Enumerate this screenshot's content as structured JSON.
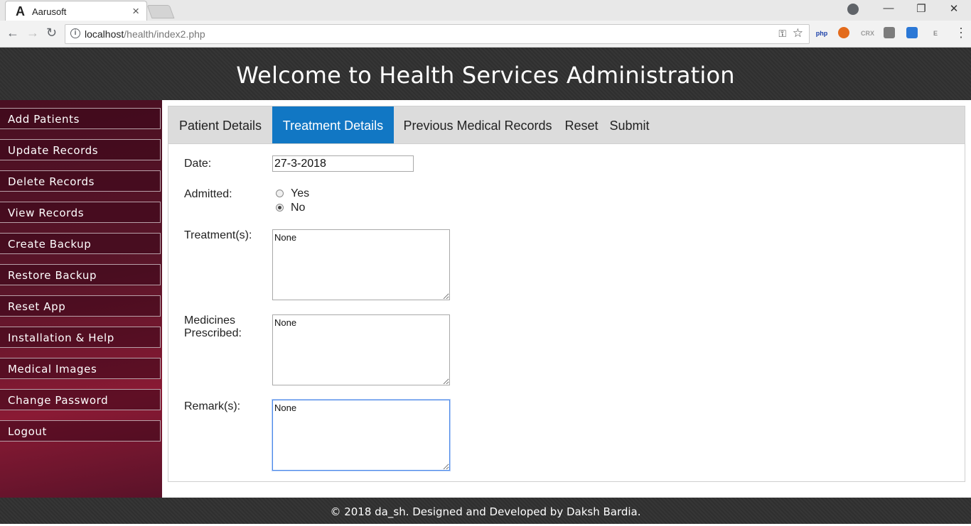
{
  "browser": {
    "tab_logo": "A",
    "tab_title": "Aarusoft",
    "tab_close": "×",
    "url_host": "localhost",
    "url_path": "/health/index2.php",
    "extensions": [
      {
        "name": "php-extension-icon",
        "label": "php",
        "color": "#1a3fa8"
      },
      {
        "name": "orange-ball-extension-icon",
        "label": "",
        "color": "#e36b1c"
      },
      {
        "name": "crx-extension-icon",
        "label": "CRX",
        "color": "#9b9b9b"
      },
      {
        "name": "cube-extension-icon",
        "label": "",
        "color": "#7c7c7c"
      },
      {
        "name": "notepad-extension-icon",
        "label": "",
        "color": "#2b78d6"
      },
      {
        "name": "e-extension-icon",
        "label": "E",
        "color": "#8a8a8a"
      }
    ]
  },
  "header": {
    "title": "Welcome to Health Services Administration"
  },
  "sidebar": {
    "items": [
      {
        "label": "Add Patients"
      },
      {
        "label": "Update Records"
      },
      {
        "label": "Delete Records"
      },
      {
        "label": "View Records"
      },
      {
        "label": "Create Backup"
      },
      {
        "label": "Restore Backup"
      },
      {
        "label": "Reset App"
      },
      {
        "label": "Installation & Help"
      },
      {
        "label": "Medical Images"
      },
      {
        "label": "Change Password"
      },
      {
        "label": "Logout"
      }
    ]
  },
  "tabs": [
    {
      "label": "Patient Details",
      "active": false
    },
    {
      "label": "Treatment Details",
      "active": true
    },
    {
      "label": "Previous Medical Records",
      "active": false
    },
    {
      "label": "Reset",
      "active": false
    },
    {
      "label": "Submit",
      "active": false
    }
  ],
  "form": {
    "date_label": "Date:",
    "date_value": "27-3-2018",
    "admitted_label": "Admitted:",
    "admitted_options": [
      "Yes",
      "No"
    ],
    "admitted_selected": "No",
    "treatments_label": "Treatment(s):",
    "treatments_value": "None",
    "medicines_label_1": "Medicines",
    "medicines_label_2": "Prescribed:",
    "medicines_value": "None",
    "remarks_label": "Remark(s):",
    "remarks_value": "None"
  },
  "footer": {
    "text": "© 2018 da_sh. Designed and Developed by Daksh Bardia."
  },
  "colors": {
    "header_bg": "#2f2f2f",
    "active_tab": "#1177c4",
    "sidebar_bg": "#5a1529"
  }
}
